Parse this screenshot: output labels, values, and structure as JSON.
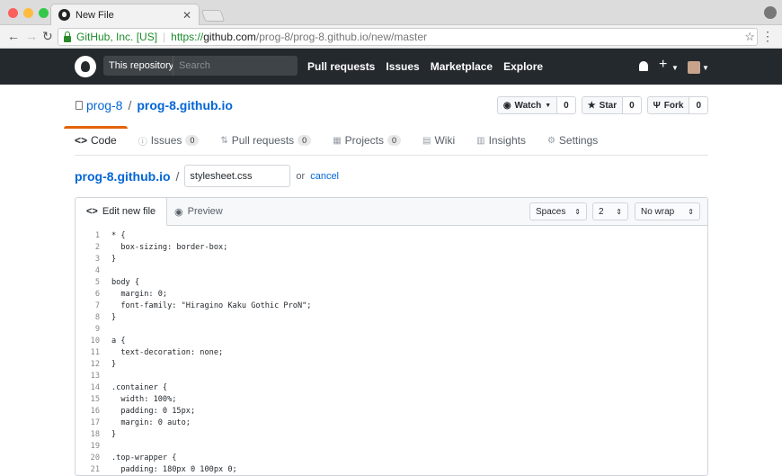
{
  "browser": {
    "tab_title": "New File",
    "org": "GitHub, Inc. [US]",
    "url_proto": "https://",
    "url_host": "github.com",
    "url_path": "/prog-8/prog-8.github.io/new/master"
  },
  "header": {
    "scope": "This repository",
    "search_placeholder": "Search",
    "nav": [
      "Pull requests",
      "Issues",
      "Marketplace",
      "Explore"
    ]
  },
  "repo": {
    "owner": "prog-8",
    "name": "prog-8.github.io",
    "watch_label": "Watch",
    "watch_count": "0",
    "star_label": "Star",
    "star_count": "0",
    "fork_label": "Fork",
    "fork_count": "0"
  },
  "tabs": [
    {
      "label": "Code",
      "count": ""
    },
    {
      "label": "Issues",
      "count": "0"
    },
    {
      "label": "Pull requests",
      "count": "0"
    },
    {
      "label": "Projects",
      "count": "0"
    },
    {
      "label": "Wiki",
      "count": ""
    },
    {
      "label": "Insights",
      "count": ""
    },
    {
      "label": "Settings",
      "count": ""
    }
  ],
  "file": {
    "crumb": "prog-8.github.io",
    "filename": "stylesheet.css",
    "or": "or",
    "cancel": "cancel"
  },
  "editor": {
    "edit_tab": "Edit new file",
    "preview_tab": "Preview",
    "indent_mode": "Spaces",
    "indent_size": "2",
    "wrap_mode": "No wrap",
    "lines": [
      "* {",
      "  box-sizing: border-box;",
      "}",
      "",
      "body {",
      "  margin: 0;",
      "  font-family: \"Hiragino Kaku Gothic ProN\";",
      "}",
      "",
      "a {",
      "  text-decoration: none;",
      "}",
      "",
      ".container {",
      "  width: 100%;",
      "  padding: 0 15px;",
      "  margin: 0 auto;",
      "}",
      "",
      ".top-wrapper {",
      "  padding: 180px 0 100px 0;"
    ]
  }
}
